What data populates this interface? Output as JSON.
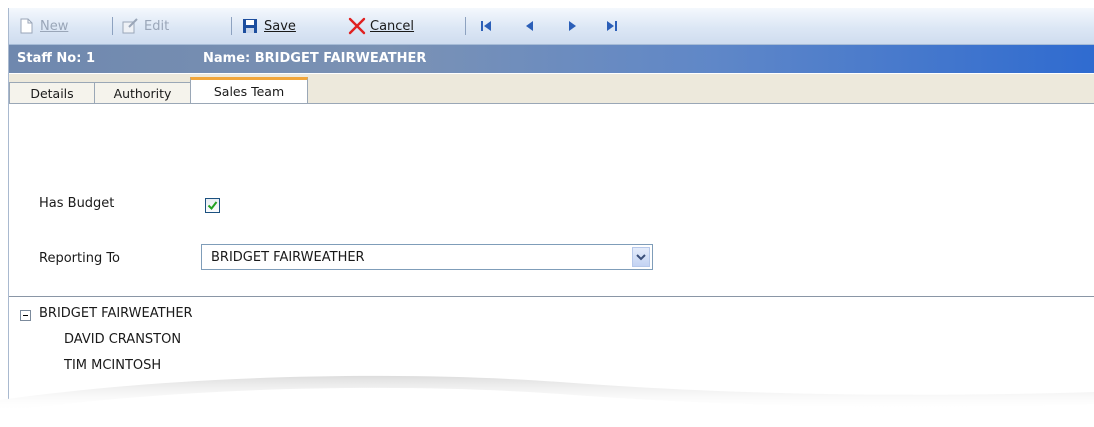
{
  "toolbar": {
    "new_label": "New",
    "edit_label": "Edit",
    "save_label": "Save",
    "cancel_label": "Cancel",
    "new_icon": "new-document-icon",
    "edit_icon": "edit-icon",
    "save_icon": "floppy-disk-icon",
    "cancel_icon": "red-x-icon",
    "nav_icons": [
      "first-record-icon",
      "previous-record-icon",
      "next-record-icon",
      "last-record-icon"
    ]
  },
  "header": {
    "staff_no": "Staff No: 1",
    "name": "Name: BRIDGET FAIRWEATHER"
  },
  "tabs": [
    {
      "label": "Details",
      "active": false
    },
    {
      "label": "Authority",
      "active": false
    },
    {
      "label": "Sales Team",
      "active": true
    }
  ],
  "form": {
    "has_budget_label": "Has Budget",
    "has_budget_checked": true,
    "reporting_to_label": "Reporting To",
    "reporting_to_value": "BRIDGET FAIRWEATHER"
  },
  "tree": {
    "root": "BRIDGET FAIRWEATHER",
    "children": [
      "DAVID CRANSTON",
      "TIM MCINTOSH"
    ]
  },
  "colors": {
    "accent_tab": "#f2a63a",
    "header_bar": "#2f6bd0",
    "cancel_red": "#e02020",
    "save_blue": "#1d4e9e"
  }
}
